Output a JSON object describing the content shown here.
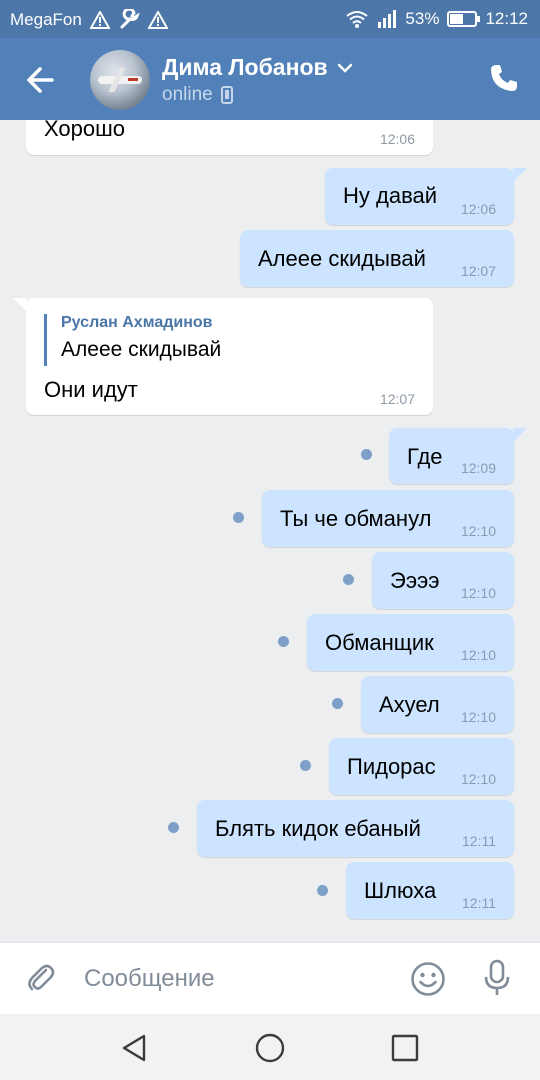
{
  "status_bar": {
    "carrier": "MegaFon",
    "battery_percent": "53%",
    "battery_level": 0.53,
    "time": "12:12",
    "icons": [
      "warning-icon",
      "wrench-icon",
      "warning-icon",
      "wifi-icon",
      "signal-icon",
      "battery-icon"
    ]
  },
  "header": {
    "contact_name": "Дима Лобанов",
    "status": "online",
    "icons": [
      "back-arrow-icon",
      "chevron-down-icon",
      "mobile-icon",
      "phone-icon"
    ]
  },
  "messages": [
    {
      "direction": "in",
      "text": "Хорошо",
      "time": "12:06"
    },
    {
      "direction": "out",
      "text": "Ну давай",
      "time": "12:06",
      "unread": false
    },
    {
      "direction": "out",
      "text": "Алеее скидывай",
      "time": "12:07",
      "unread": false
    },
    {
      "direction": "in",
      "reply_author": "Руслан Ахмадинов",
      "reply_text": "Алеее скидывай",
      "text": "Они идут",
      "time": "12:07"
    },
    {
      "direction": "out",
      "text": "Где",
      "time": "12:09",
      "unread": true
    },
    {
      "direction": "out",
      "text": "Ты че обманул",
      "time": "12:10",
      "unread": true
    },
    {
      "direction": "out",
      "text": "Ээээ",
      "time": "12:10",
      "unread": true
    },
    {
      "direction": "out",
      "text": "Обманщик",
      "time": "12:10",
      "unread": true
    },
    {
      "direction": "out",
      "text": "Ахуел",
      "time": "12:10",
      "unread": true
    },
    {
      "direction": "out",
      "text": "Пидорас",
      "time": "12:10",
      "unread": true
    },
    {
      "direction": "out",
      "text": "Блять кидок ебаный",
      "time": "12:11",
      "unread": true
    },
    {
      "direction": "out",
      "text": "Шлюха",
      "time": "12:11",
      "unread": true
    }
  ],
  "composer": {
    "placeholder": "Сообщение",
    "value": "",
    "icons": [
      "paperclip-icon",
      "smile-icon",
      "microphone-icon"
    ]
  },
  "nav_bar": {
    "icons": [
      "nav-back-icon",
      "nav-home-icon",
      "nav-recents-icon"
    ]
  },
  "colors": {
    "header": "#5181b8",
    "status_bar": "#4d77a8",
    "incoming_bubble": "#ffffff",
    "outgoing_bubble": "#cce4ff",
    "chat_background": "#edeef0",
    "unread_dot": "#7d9fc8"
  }
}
